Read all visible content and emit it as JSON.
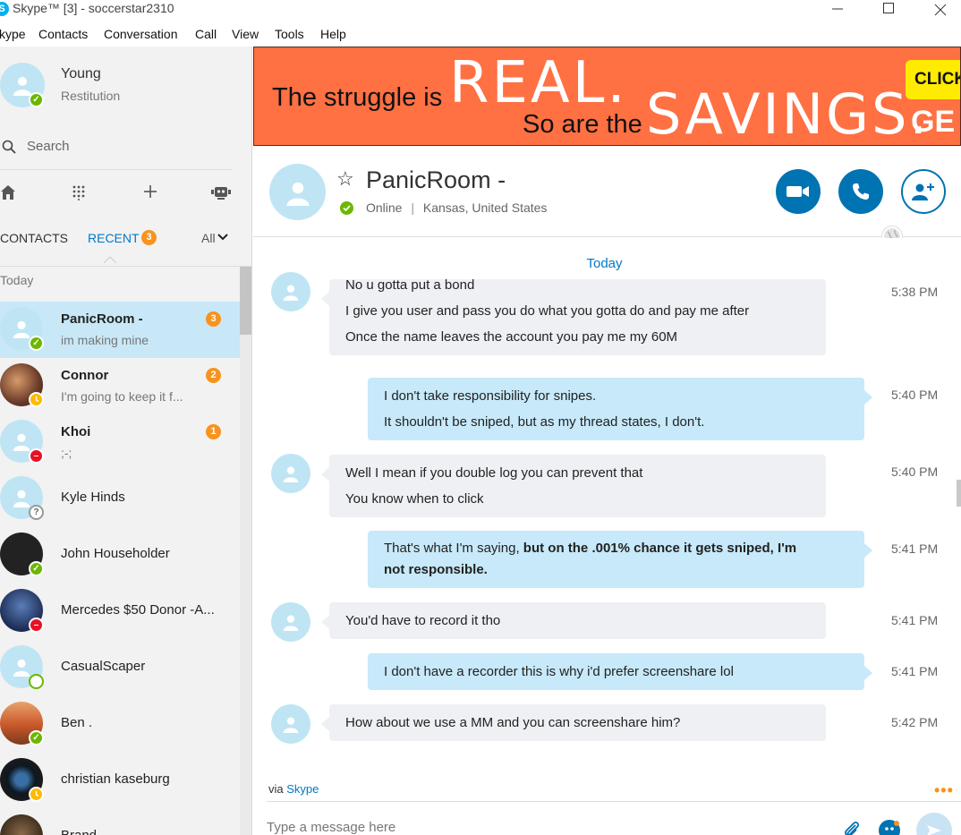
{
  "window": {
    "title": "Skype™ [3] - soccerstar2310",
    "app_icon_letter": "S"
  },
  "menu": [
    "kype",
    "Contacts",
    "Conversation",
    "Call",
    "View",
    "Tools",
    "Help"
  ],
  "profile": {
    "name": "Young",
    "mood": "Restitution",
    "status": "online"
  },
  "search": {
    "placeholder": "Search"
  },
  "tabs": {
    "contacts": "CONTACTS",
    "recent": "RECENT",
    "recent_badge": "3",
    "filter": "All"
  },
  "section": {
    "today": "Today"
  },
  "contacts": [
    {
      "name": "PanicRoom -",
      "message": "im making mine",
      "badge": "3",
      "status": "online",
      "bold": true,
      "active": true,
      "avatar": "default"
    },
    {
      "name": "Connor",
      "message": "I'm going to keep it f...",
      "badge": "2",
      "status": "away",
      "bold": true,
      "active": false,
      "avatar": "photo1"
    },
    {
      "name": "Khoi",
      "message": ";-;",
      "badge": "1",
      "status": "dnd",
      "bold": true,
      "active": false,
      "avatar": "default"
    },
    {
      "name": "Kyle Hinds",
      "message": "",
      "badge": "",
      "status": "unknown",
      "bold": false,
      "active": false,
      "avatar": "default"
    },
    {
      "name": "John Householder",
      "message": "",
      "badge": "",
      "status": "online",
      "bold": false,
      "active": false,
      "avatar": "dark"
    },
    {
      "name": "Mercedes $50 Donor -A...",
      "message": "",
      "badge": "",
      "status": "dnd",
      "bold": false,
      "active": false,
      "avatar": "photo2"
    },
    {
      "name": "CasualScaper",
      "message": "",
      "badge": "",
      "status": "offline",
      "bold": false,
      "active": false,
      "avatar": "default"
    },
    {
      "name": "Ben .",
      "message": "",
      "badge": "",
      "status": "online",
      "bold": false,
      "active": false,
      "avatar": "photo3"
    },
    {
      "name": "christian kaseburg",
      "message": "",
      "badge": "",
      "status": "away",
      "bold": false,
      "active": false,
      "avatar": "photo4"
    },
    {
      "name": "Brand...",
      "message": "",
      "badge": "",
      "status": "",
      "bold": false,
      "active": false,
      "avatar": "photo5"
    }
  ],
  "ad": {
    "line1": "The struggle is",
    "real": "REAL.",
    "line2": "So are the",
    "savings": "SAVINGS.",
    "click": "CLICK",
    "ge": "GE"
  },
  "conversation": {
    "name": "PanicRoom -",
    "status": "Online",
    "location": "Kansas, United States",
    "separator": "|",
    "day": "Today"
  },
  "messages": [
    {
      "dir": "in",
      "lines": [
        "No u gotta put a bond",
        "I give you user and pass you do what you gotta do and pay me after",
        "Once the name leaves the account you pay me my 60M"
      ],
      "time": "5:38 PM"
    },
    {
      "dir": "out",
      "lines": [
        "I don't take responsibility for snipes.",
        "It shouldn't be sniped, but as my thread states, I don't."
      ],
      "time": "5:40 PM"
    },
    {
      "dir": "in",
      "lines": [
        "Well I mean if you double log you can prevent that",
        "You know when to click"
      ],
      "time": "5:40 PM"
    },
    {
      "dir": "out",
      "plain": "That's what I'm saying, ",
      "bold1": "but on the .001% chance it gets sniped, I'm",
      "bold2": "not responsible.",
      "time": "5:41 PM"
    },
    {
      "dir": "in",
      "lines": [
        "You'd have to record it tho"
      ],
      "time": "5:41 PM"
    },
    {
      "dir": "out",
      "lines": [
        "I don't have a recorder this is why i'd prefer screenshare lol"
      ],
      "time": "5:41 PM"
    },
    {
      "dir": "in",
      "lines": [
        "How about we use a MM and you can screenshare him?"
      ],
      "time": "5:42 PM"
    }
  ],
  "footer": {
    "via": "via",
    "via_link": "Skype",
    "more": "•••",
    "input_placeholder": "Type a message here"
  },
  "colors": {
    "accent": "#0073b2",
    "link": "#0078ca",
    "badge": "#f7931e",
    "online": "#6bb700",
    "away": "#ffb900",
    "dnd": "#e81123",
    "ad_bg": "#ff7043"
  }
}
